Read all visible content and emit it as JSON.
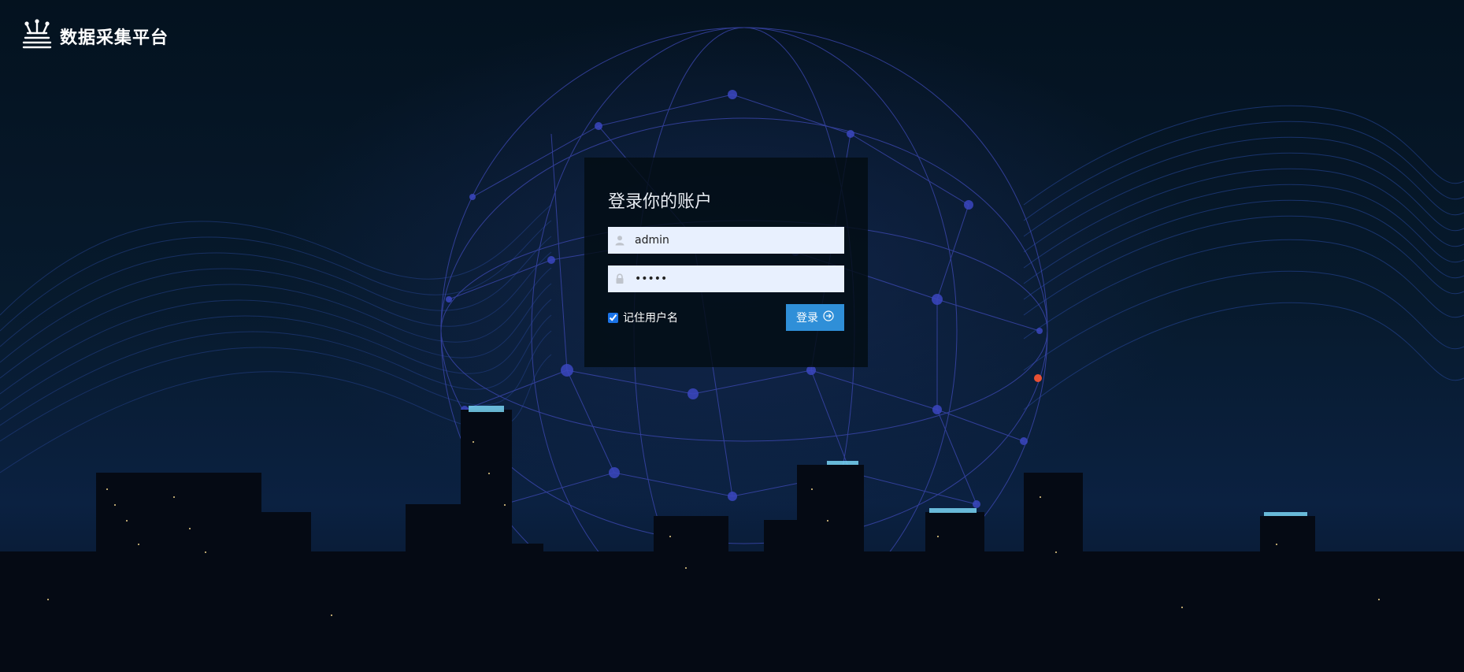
{
  "app": {
    "title": "数据采集平台"
  },
  "login": {
    "heading": "登录你的账户",
    "username_value": "admin",
    "password_value": "•••••",
    "remember_label": "记住用户名",
    "remember_checked": true,
    "submit_label": "登录"
  },
  "icons": {
    "logo": "logo-icon",
    "user": "user-icon",
    "lock": "lock-icon",
    "arrow": "arrow-circle-right-icon"
  },
  "colors": {
    "accent": "#2f8fd8",
    "input_bg": "#e8f0fe",
    "panel_bg": "#020c12"
  }
}
